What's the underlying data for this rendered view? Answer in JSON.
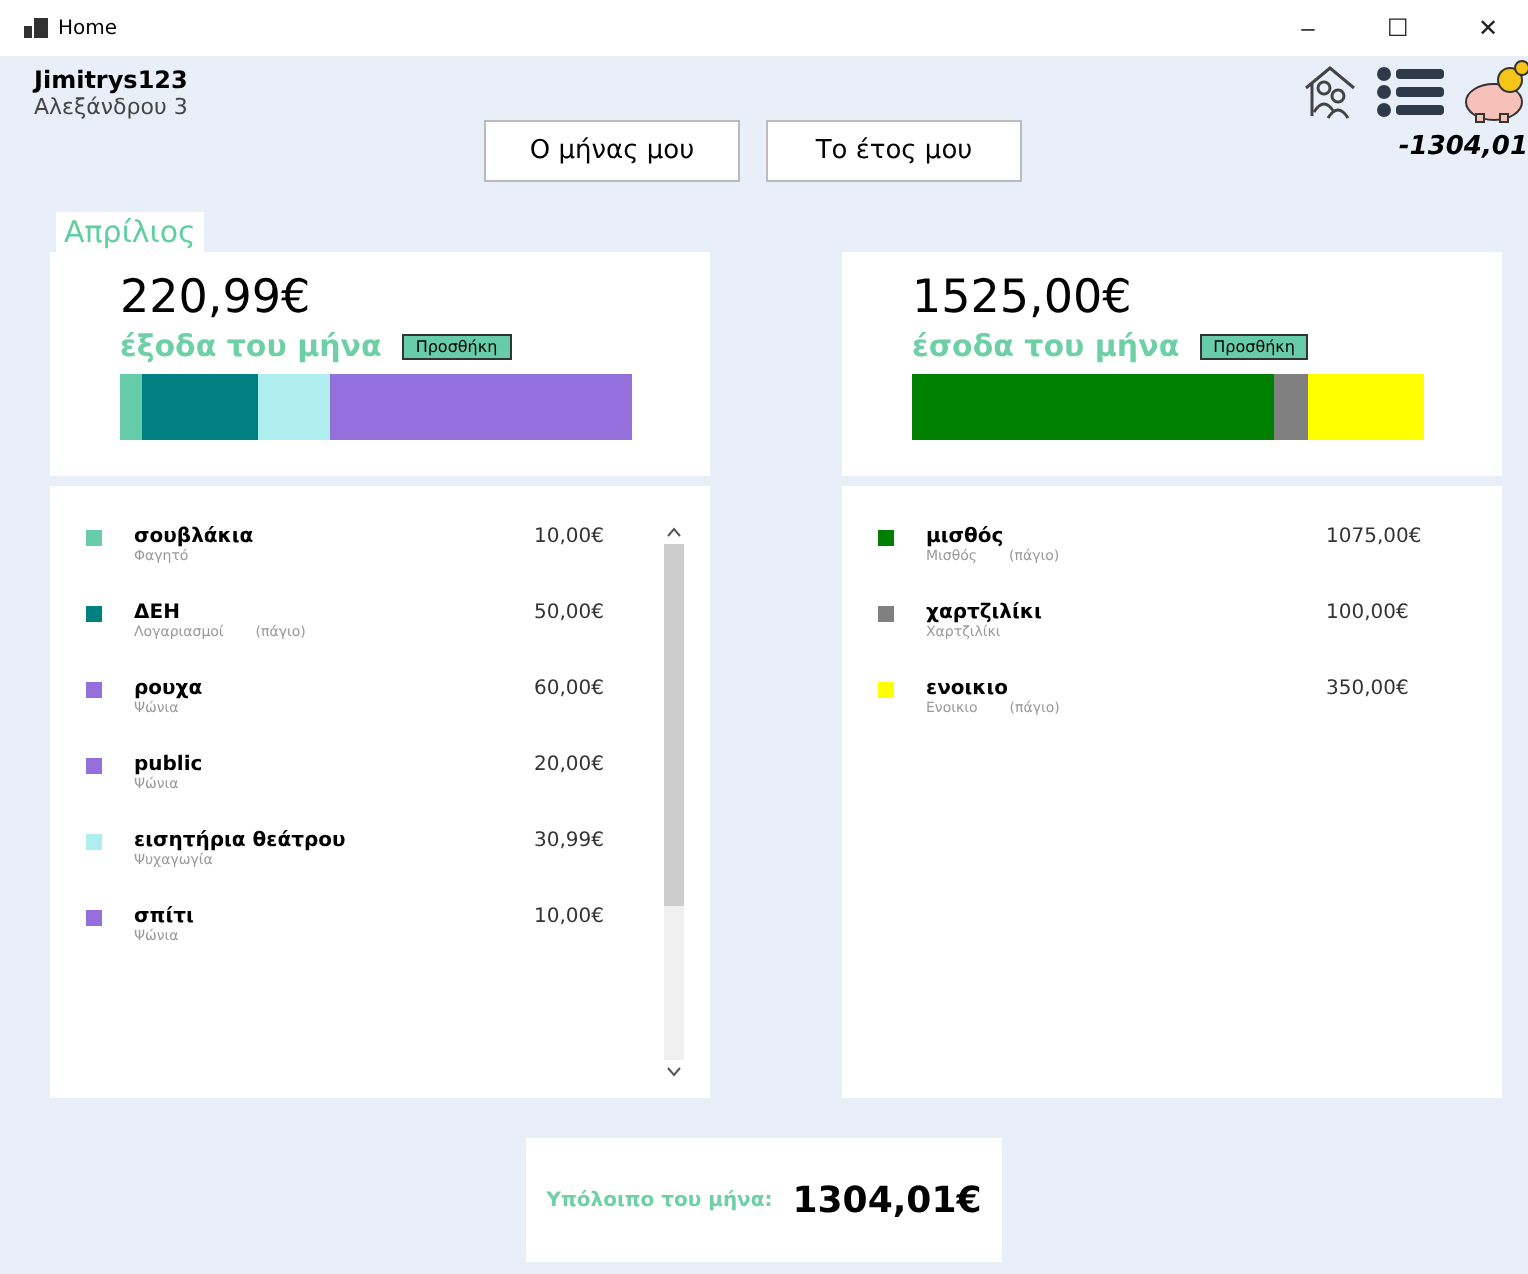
{
  "window": {
    "title": "Home",
    "controls": [
      "–",
      "☐",
      "✕"
    ]
  },
  "user": {
    "name": "Jimitrys123",
    "address": "Αλεξάνδρου 3"
  },
  "nav_buttons": [
    "Ο μήνας μου",
    "Το έτος μου"
  ],
  "balance_badge": "-1304,01",
  "month_tab": "Απρίλιος",
  "panels": [
    {
      "total": "220,99€",
      "label": "έξοδα του μήνα",
      "add_button": "Προσθήκη",
      "scrollable": true,
      "segments": [
        {
          "color": "#66ccaa"
        },
        {
          "color": "#008080"
        },
        {
          "color": "#afeeee"
        },
        {
          "color": "#9370db"
        }
      ],
      "items": [
        {
          "name": "σουβλάκια",
          "category": "Φαγητό",
          "amount": "10,00€",
          "color": "#66ccaa"
        },
        {
          "name": "ΔΕΗ",
          "category": "Λογαριασμοί",
          "note": "(πάγιο)",
          "amount": "50,00€",
          "color": "#008080"
        },
        {
          "name": "ρουχα",
          "category": "Ψώνια",
          "amount": "60,00€",
          "color": "#9370db"
        },
        {
          "name": "public",
          "category": "Ψώνια",
          "amount": "20,00€",
          "color": "#9370db"
        },
        {
          "name": "εισητήρια θεάτρου",
          "category": "Ψυχαγωγία",
          "amount": "30,99€",
          "color": "#afeeee"
        },
        {
          "name": "σπίτι",
          "category": "Ψώνια",
          "amount": "10,00€",
          "color": "#9370db"
        }
      ]
    },
    {
      "total": "1525,00€",
      "label": "έσοδα του μήνα",
      "add_button": "Προσθήκη",
      "scrollable": false,
      "segments": [
        {
          "color": "#008000"
        },
        {
          "color": "#808080"
        },
        {
          "color": "#ffff00"
        }
      ],
      "items": [
        {
          "name": "μισθός",
          "category": "Μισθός",
          "note": "(πάγιο)",
          "amount": "1075,00€",
          "color": "#008000"
        },
        {
          "name": "χαρτζιλίκι",
          "category": "Χαρτζιλίκι",
          "amount": "100,00€",
          "color": "#808080"
        },
        {
          "name": "ενοικιο",
          "category": "Ενοικιο",
          "note": "(πάγιο)",
          "amount": "350,00€",
          "color": "#ffff00"
        }
      ]
    }
  ],
  "remainder": {
    "label": "Υπόλοιπο του μήνα:",
    "value": "1304,01€"
  }
}
